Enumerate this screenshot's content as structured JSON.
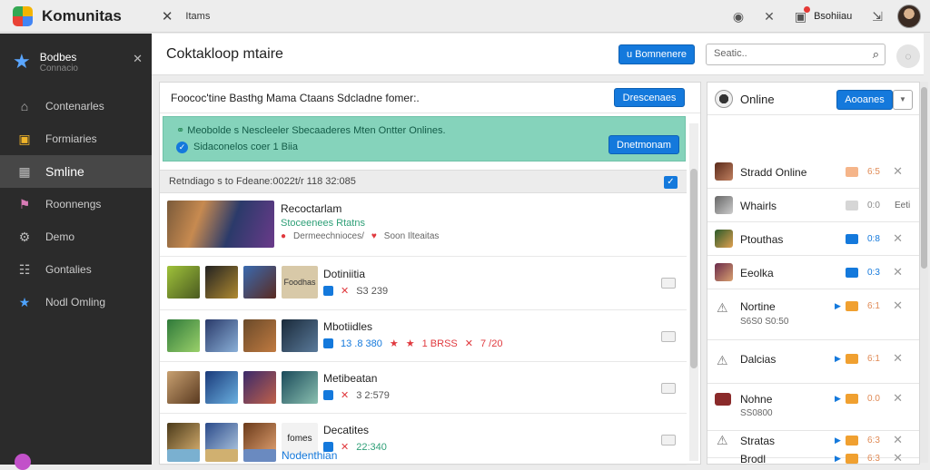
{
  "app": {
    "title": "Komunitas",
    "tab_label": "Itams",
    "user_label": "Bsohiiau"
  },
  "sidebar": {
    "header_title": "Bodbes",
    "header_sub": "Connacio",
    "items": [
      {
        "label": "Contenarles",
        "icon": "home-icon"
      },
      {
        "label": "Formiaries",
        "icon": "star-square-icon"
      },
      {
        "label": "Smline",
        "icon": "chart-icon",
        "active": true
      },
      {
        "label": "Roonnengs",
        "icon": "flag-icon"
      },
      {
        "label": "Demo",
        "icon": "gear-icon"
      },
      {
        "label": "Gontalies",
        "icon": "users-icon"
      },
      {
        "label": "Nodl Omling",
        "icon": "star-icon"
      }
    ]
  },
  "header": {
    "page_title": "Coktakloop mtaire",
    "button_label": "u Bomnenere",
    "search_placeholder": "Seatic.."
  },
  "feed": {
    "top_text": "Foococ'tine Basthg Mama Ctaans Sdcladne fomer:.",
    "top_button": "Drescenaes",
    "notice_line1": "Meobolde s Nescleeler Sbecaaderes Mten Ontter Onlines.",
    "notice_line2": "Sidaconelos coer 1 Biia",
    "notice_button": "Dnetmonam",
    "subheader": "Retndiago  s to Fdeane:0022t/r 118 32:085",
    "rows": [
      {
        "title": "Recoctarlam",
        "subtitle": "Stoceenees Rtatns",
        "meta1": "Dermeechnioces/",
        "meta2": "Soon Ilteaitas"
      },
      {
        "tag": "Foodhas",
        "title": "Dotiniitia",
        "meta": "S3 239"
      },
      {
        "title": "Mbotiidles",
        "meta_a": "13 .8 380",
        "meta_b": "1 BRSS",
        "meta_c": "7 /20"
      },
      {
        "title": "Metibeatan",
        "meta": "3  2:579"
      },
      {
        "tag": "fomes",
        "title": "Decatites",
        "meta": "22:340"
      },
      {
        "title": "Nodenthian"
      }
    ]
  },
  "panel": {
    "header_label": "Online",
    "header_button": "Aooanes",
    "rows": [
      {
        "name": "Stradd Online",
        "val": "6:5"
      },
      {
        "name": "Whairls",
        "val": "0:0",
        "extra": "Eeti"
      },
      {
        "name": "Ptouthas",
        "val": "0:8"
      },
      {
        "name": "Eeolka",
        "val": "0:3"
      },
      {
        "name": "Nortine",
        "sub": "S6S0 S0:50",
        "val": "6:1"
      },
      {
        "name": "Dalcias",
        "val": "6:1"
      },
      {
        "name": "Nohne",
        "sub": "SS0800",
        "val": "0.0"
      },
      {
        "name": "Stratas",
        "val": "6:3"
      },
      {
        "name": "Brodl",
        "val": "6:3"
      }
    ]
  }
}
